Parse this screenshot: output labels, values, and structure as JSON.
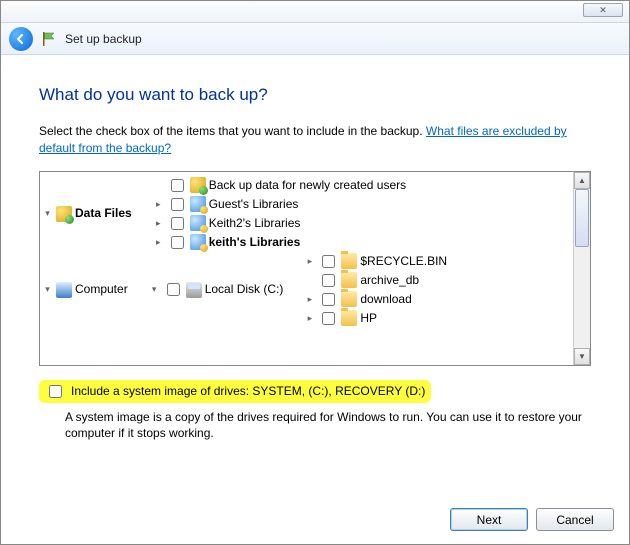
{
  "window": {
    "close_glyph": "✕"
  },
  "breadcrumb": {
    "title": "Set up backup"
  },
  "heading": "What do you want to back up?",
  "instruction": {
    "text": "Select the check box of the items that you want to include in the backup. ",
    "link": "What files are excluded by default from the backup?"
  },
  "tree": {
    "data_files": "Data Files",
    "new_users": "Back up data for newly created users",
    "guest": "Guest's Libraries",
    "keith2": "Keith2's Libraries",
    "keith": "keith's Libraries",
    "computer": "Computer",
    "local_disk": "Local Disk (C:)",
    "recycle": "$RECYCLE.BIN",
    "archive": "archive_db",
    "download": "download",
    "hp": "HP"
  },
  "system_image": {
    "label": "Include a system image of drives: SYSTEM, (C:), RECOVERY (D:)",
    "desc": "A system image is a copy of the drives required for Windows to run. You can use it to restore your computer if it stops working."
  },
  "buttons": {
    "next": "Next",
    "cancel": "Cancel"
  }
}
